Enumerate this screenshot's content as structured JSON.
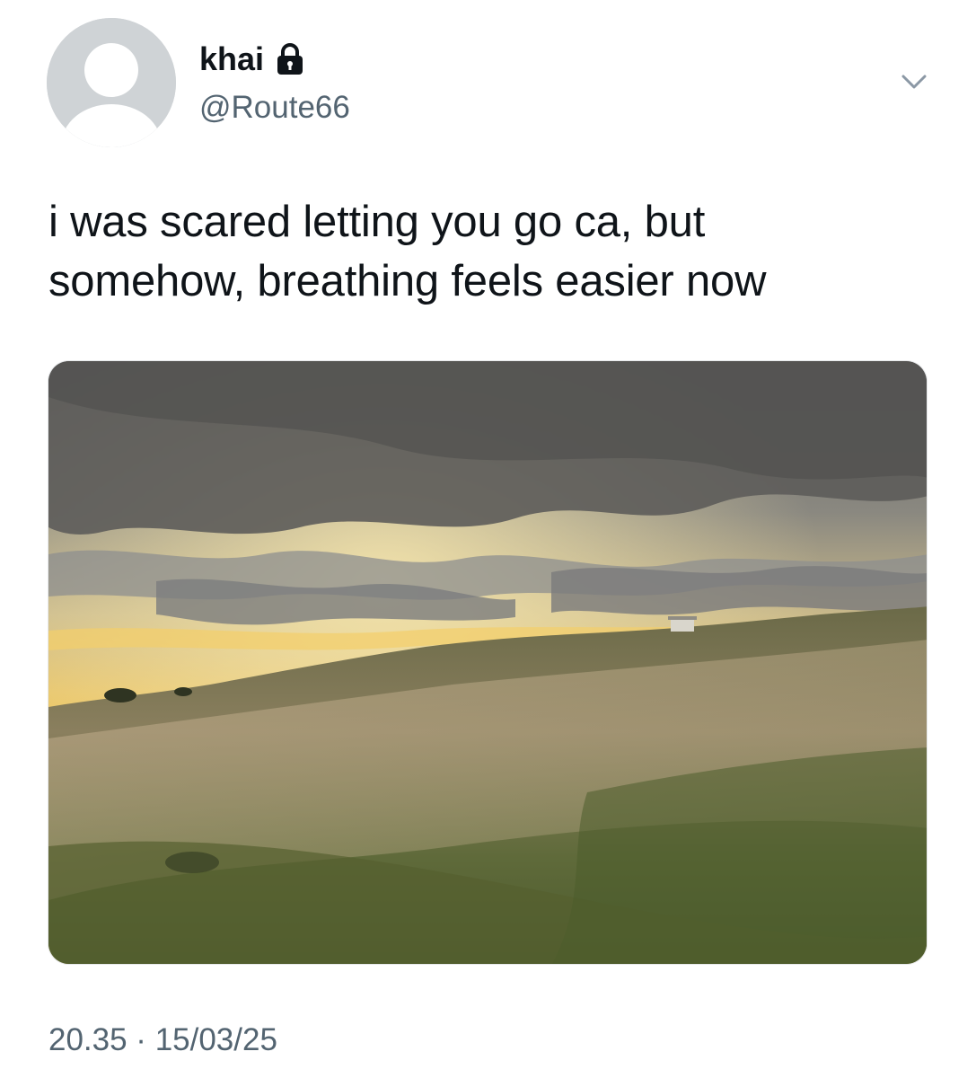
{
  "author": {
    "display_name": "khai",
    "handle": "@Route66",
    "avatar_icon": "default-avatar-icon",
    "protected_icon": "lock-icon"
  },
  "menu": {
    "icon": "chevron-down-icon"
  },
  "tweet": {
    "text_lines": [
      "i was scared letting you go ca, but",
      "somehow, breathing feels easier now"
    ],
    "media_description_icon": "photo"
  },
  "meta": {
    "timestamp": "20.35 · 15/03/25"
  },
  "colors": {
    "text_primary": "#0f1419",
    "text_secondary": "#536471",
    "avatar_bg": "#cfd3d6"
  }
}
